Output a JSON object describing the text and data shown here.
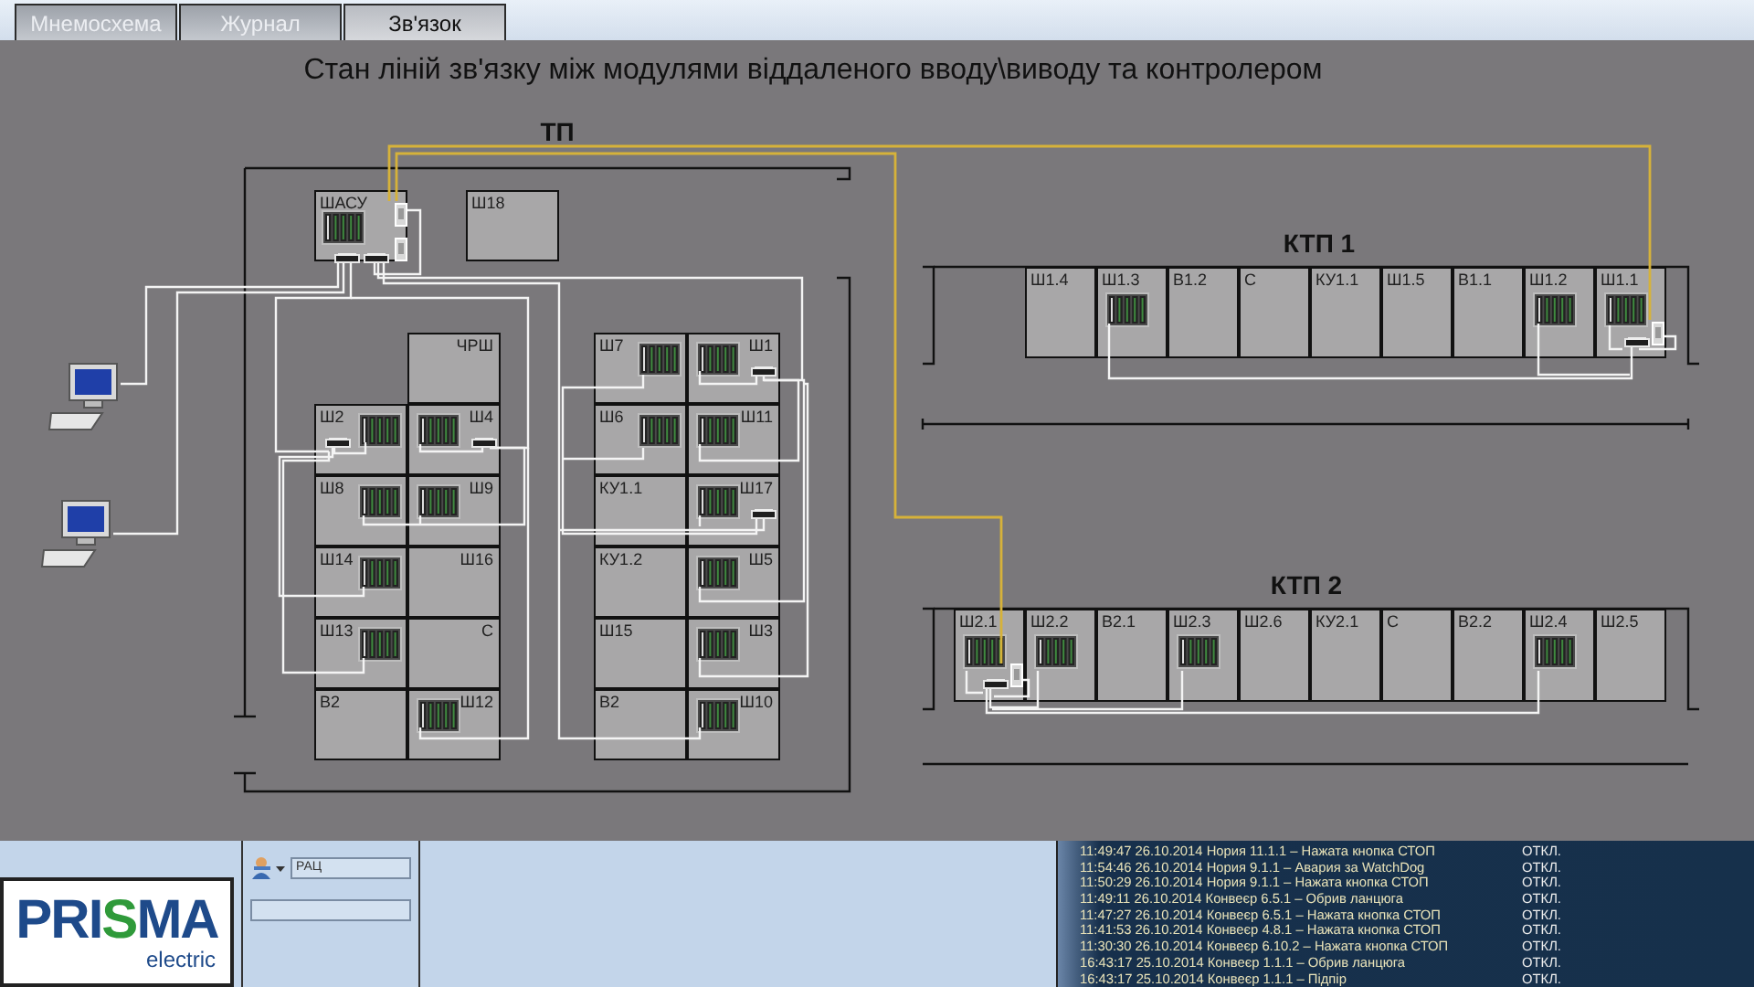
{
  "tabs": [
    {
      "label": "Мнемосхема",
      "selected": false
    },
    {
      "label": "Журнал",
      "selected": false
    },
    {
      "label": "Зв'язок",
      "selected": true
    }
  ],
  "title": "Стан ліній зв'язку між модулями віддаленого вводу\\виводу та контролером",
  "tp": {
    "label": "ТП",
    "head": [
      {
        "label": "ШАСУ",
        "module": true,
        "hub": true,
        "converter": true,
        "kind": "master"
      },
      {
        "label": "Ш18",
        "module": false,
        "hub": false,
        "converter": false,
        "kind": "plain"
      }
    ],
    "blocks": [
      {
        "rows": [
          [
            null,
            {
              "label": "ЧРШ",
              "module": false,
              "hub": false
            }
          ],
          [
            {
              "label": "Ш2",
              "module": true,
              "hub": true
            },
            {
              "label": "Ш4",
              "module": true,
              "hub": true
            }
          ],
          [
            {
              "label": "Ш8",
              "module": true,
              "hub": false
            },
            {
              "label": "Ш9",
              "module": true,
              "hub": false
            }
          ],
          [
            {
              "label": "Ш14",
              "module": true,
              "hub": false
            },
            {
              "label": "Ш16",
              "module": false,
              "hub": false
            }
          ],
          [
            {
              "label": "Ш13",
              "module": true,
              "hub": false
            },
            {
              "label": "С",
              "module": false,
              "hub": false
            }
          ],
          [
            {
              "label": "В2",
              "module": false,
              "hub": false
            },
            {
              "label": "Ш12",
              "module": true,
              "hub": false
            }
          ]
        ]
      },
      {
        "rows": [
          [
            {
              "label": "Ш7",
              "module": true,
              "hub": false
            },
            {
              "label": "Ш1",
              "module": true,
              "hub": true
            }
          ],
          [
            {
              "label": "Ш6",
              "module": true,
              "hub": false
            },
            {
              "label": "Ш11",
              "module": true,
              "hub": false
            }
          ],
          [
            {
              "label": "КУ1.1",
              "module": false,
              "hub": false
            },
            {
              "label": "Ш17",
              "module": true,
              "hub": true
            }
          ],
          [
            {
              "label": "КУ1.2",
              "module": false,
              "hub": false
            },
            {
              "label": "Ш5",
              "module": true,
              "hub": false
            }
          ],
          [
            {
              "label": "Ш15",
              "module": false,
              "hub": false
            },
            {
              "label": "Ш3",
              "module": true,
              "hub": false
            }
          ],
          [
            {
              "label": "В2",
              "module": false,
              "hub": false
            },
            {
              "label": "Ш10",
              "module": true,
              "hub": false
            }
          ]
        ]
      }
    ]
  },
  "substations": [
    {
      "label": "КТП 1",
      "cells": [
        {
          "label": "Ш1.4",
          "module": false,
          "hub": false,
          "converter": false
        },
        {
          "label": "Ш1.3",
          "module": true,
          "hub": false,
          "converter": false
        },
        {
          "label": "В1.2",
          "module": false,
          "hub": false,
          "converter": false
        },
        {
          "label": "С",
          "module": false,
          "hub": false,
          "converter": false
        },
        {
          "label": "КУ1.1",
          "module": false,
          "hub": false,
          "converter": false
        },
        {
          "label": "Ш1.5",
          "module": false,
          "hub": false,
          "converter": false
        },
        {
          "label": "В1.1",
          "module": false,
          "hub": false,
          "converter": false
        },
        {
          "label": "Ш1.2",
          "module": true,
          "hub": false,
          "converter": false
        },
        {
          "label": "Ш1.1",
          "module": true,
          "hub": true,
          "converter": true
        }
      ]
    },
    {
      "label": "КТП 2",
      "cells": [
        {
          "label": "Ш2.1",
          "module": true,
          "hub": true,
          "converter": true
        },
        {
          "label": "Ш2.2",
          "module": true,
          "hub": false,
          "converter": false
        },
        {
          "label": "В2.1",
          "module": false,
          "hub": false,
          "converter": false
        },
        {
          "label": "Ш2.3",
          "module": true,
          "hub": false,
          "converter": false
        },
        {
          "label": "Ш2.6",
          "module": false,
          "hub": false,
          "converter": false
        },
        {
          "label": "КУ2.1",
          "module": false,
          "hub": false,
          "converter": false
        },
        {
          "label": "С",
          "module": false,
          "hub": false,
          "converter": false
        },
        {
          "label": "В2.2",
          "module": false,
          "hub": false,
          "converter": false
        },
        {
          "label": "Ш2.4",
          "module": true,
          "hub": false,
          "converter": false
        },
        {
          "label": "Ш2.5",
          "module": false,
          "hub": false,
          "converter": false
        }
      ]
    }
  ],
  "logo": {
    "name": "PRISMA",
    "tagline": "electric"
  },
  "user_field": {
    "value": "РАЦ"
  },
  "events": [
    {
      "text": "11:49:47 26.10.2014 Нория 11.1.1 – Нажата кнопка СТОП",
      "state": "ОТКЛ."
    },
    {
      "text": "11:54:46 26.10.2014 Нория 9.1.1 – Авария за WatchDog",
      "state": "ОТКЛ."
    },
    {
      "text": "11:50:29 26.10.2014 Нория 9.1.1 – Нажата кнопка СТОП",
      "state": "ОТКЛ."
    },
    {
      "text": "11:49:11 26.10.2014 Конвеєр 6.5.1 – Обрив ланцюга",
      "state": "ОТКЛ."
    },
    {
      "text": "11:47:27 26.10.2014 Конвеєр 6.5.1 – Нажата кнопка СТОП",
      "state": "ОТКЛ."
    },
    {
      "text": "11:41:53 26.10.2014 Конвеєр 4.8.1 – Нажата кнопка СТОП",
      "state": "ОТКЛ."
    },
    {
      "text": "11:30:30 26.10.2014 Конвеєр 6.10.2 – Нажата кнопка СТОП",
      "state": "ОТКЛ."
    },
    {
      "text": "16:43:17 25.10.2014 Конвеєр 1.1.1 – Обрив ланцюга",
      "state": "ОТКЛ."
    },
    {
      "text": "16:43:17 25.10.2014 Конвеєр 1.1.1 – Підпір",
      "state": "ОТКЛ."
    }
  ]
}
